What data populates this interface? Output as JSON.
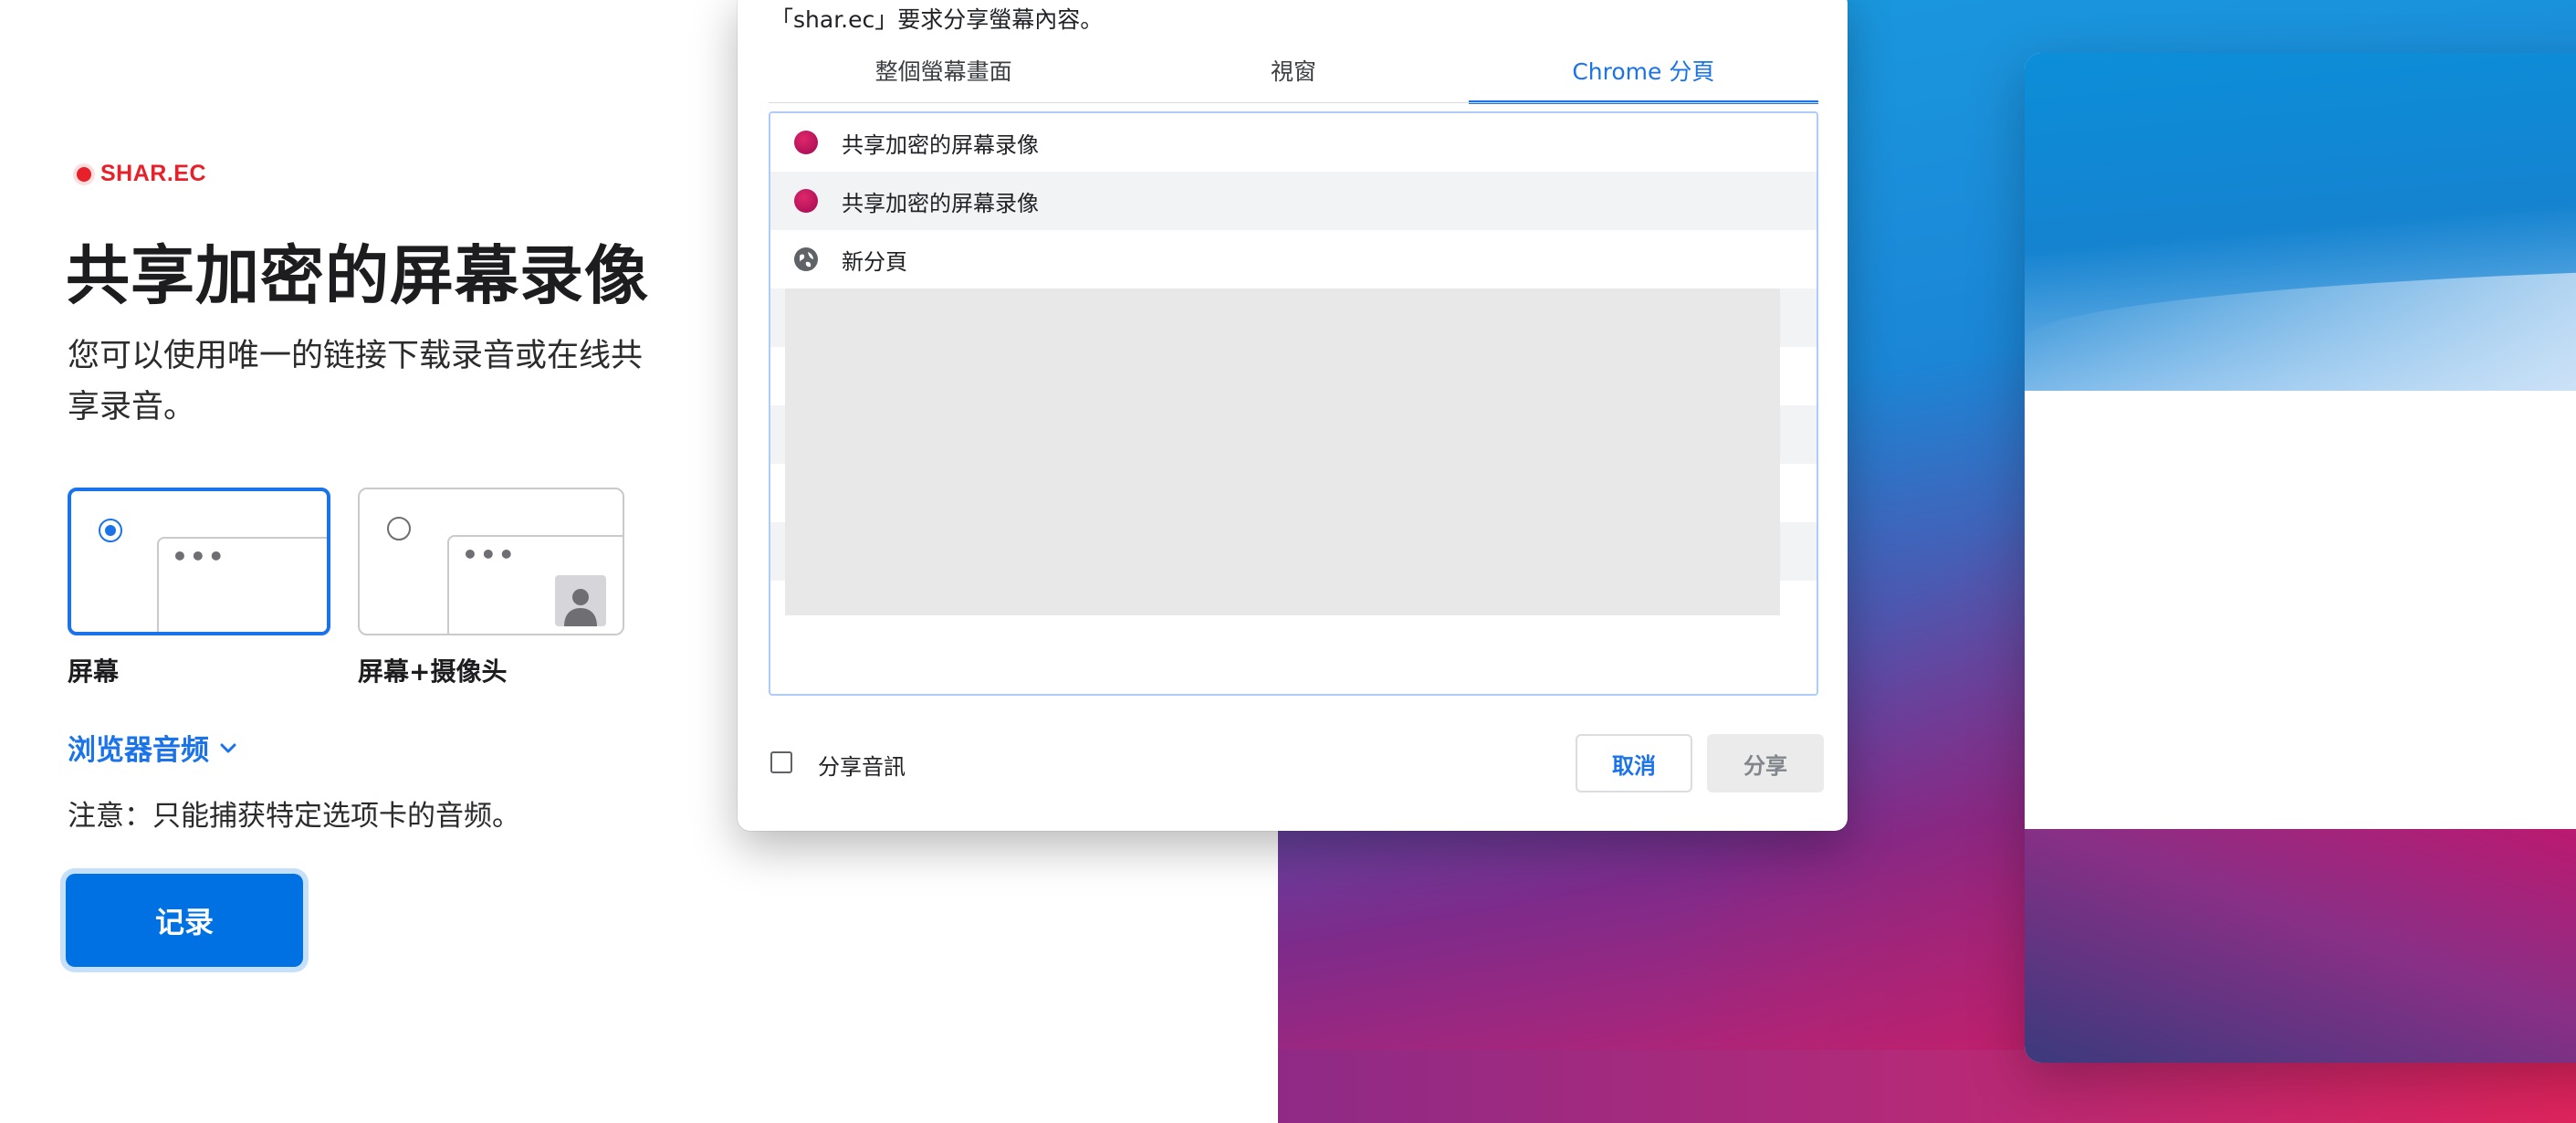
{
  "brand": {
    "name": "SHAR.EC"
  },
  "hero": {
    "title": "共享加密的屏幕录像",
    "subtitle": "您可以使用唯一的链接下载录音或在线共享录音。"
  },
  "capture_options": [
    {
      "label": "屏幕",
      "selected": true
    },
    {
      "label": "屏幕+摄像头",
      "selected": false
    }
  ],
  "audio": {
    "toggle_label": "浏览器音频",
    "note": "注意：只能捕获特定选项卡的音频。"
  },
  "record_button": {
    "label": "记录"
  },
  "share_dialog": {
    "title": "「shar.ec」要求分享螢幕內容。",
    "tabs": [
      {
        "label": "整個螢幕畫面",
        "active": false
      },
      {
        "label": "視窗",
        "active": false
      },
      {
        "label": "Chrome 分頁",
        "active": true
      }
    ],
    "sources": [
      {
        "label": "共享加密的屏幕录像",
        "icon": "site-favicon-icon"
      },
      {
        "label": "共享加密的屏幕录像",
        "icon": "site-favicon-icon",
        "selected": true
      },
      {
        "label": "新分頁",
        "icon": "globe-icon"
      }
    ],
    "share_audio_label": "分享音訊",
    "share_audio_checked": false,
    "cancel_label": "取消",
    "share_label": "分享",
    "accent_color": "#1a73e8"
  },
  "colors": {
    "brand_red": "#e8202a",
    "primary_blue": "#0071e3"
  }
}
